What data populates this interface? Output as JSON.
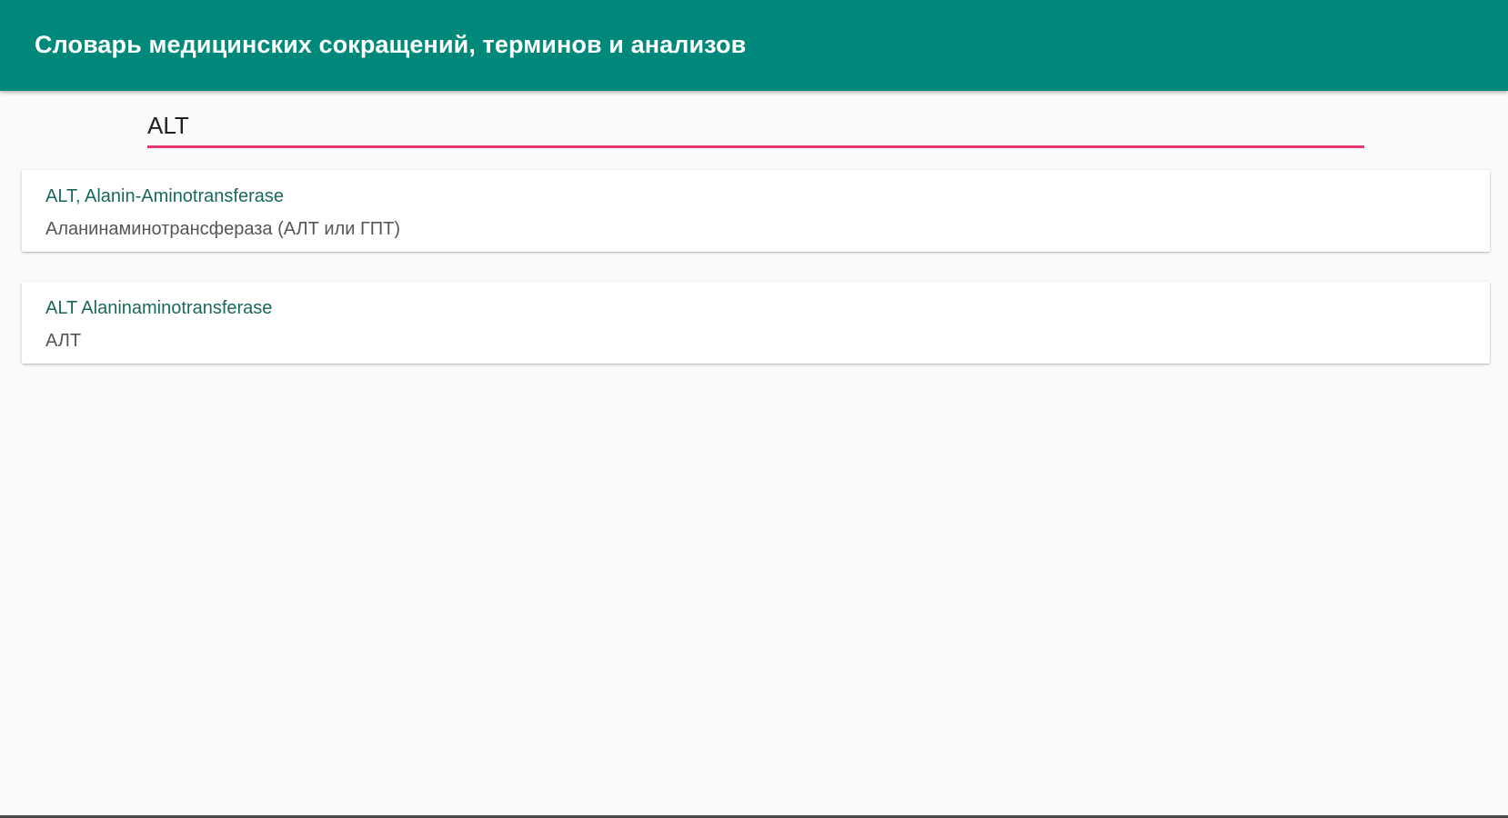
{
  "app_bar": {
    "title": "Словарь медицинских сокращений, терминов и анализов",
    "background_color": "#00897b"
  },
  "search": {
    "value": "ALT",
    "placeholder": "",
    "underline_color": "#e5396e"
  },
  "results": [
    {
      "term": "ALT, Alanin-Aminotransferase",
      "definition": "Аланинаминотрансфераза (АЛТ или ГПТ)"
    },
    {
      "term": "ALT Alaninaminotransferase",
      "definition": "АЛТ"
    }
  ]
}
